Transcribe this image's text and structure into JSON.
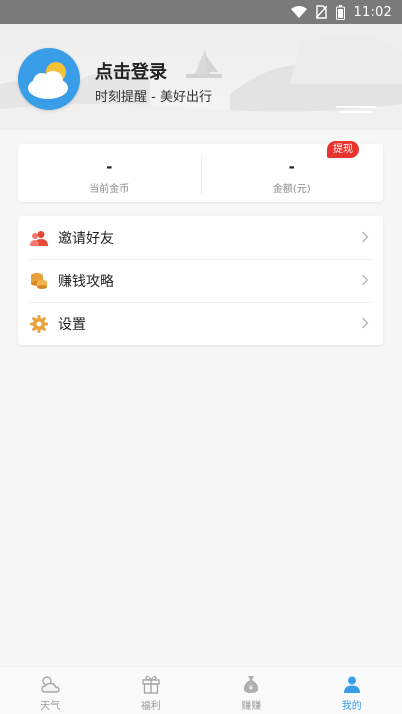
{
  "status_bar": {
    "time": "11:02"
  },
  "header": {
    "title": "点击登录",
    "subtitle": "时刻提醒 - 美好出行"
  },
  "stats": {
    "coins": {
      "value": "-",
      "label": "当前金币"
    },
    "balance": {
      "value": "-",
      "label": "金额(元)",
      "badge": "提现"
    }
  },
  "menu": [
    {
      "label": "邀请好友",
      "icon": "invite-friends-icon"
    },
    {
      "label": "赚钱攻略",
      "icon": "coins-stack-icon"
    },
    {
      "label": "设置",
      "icon": "gear-icon"
    }
  ],
  "tabs": [
    {
      "label": "天气",
      "icon": "weather-icon"
    },
    {
      "label": "福利",
      "icon": "gift-icon"
    },
    {
      "label": "赚赚",
      "icon": "money-bag-icon"
    },
    {
      "label": "我的",
      "icon": "profile-icon"
    }
  ],
  "colors": {
    "accent": "#3a9de8",
    "badge": "#e8342f",
    "icon_orange": "#e8a13a",
    "icon_red": "#e84a3a"
  }
}
